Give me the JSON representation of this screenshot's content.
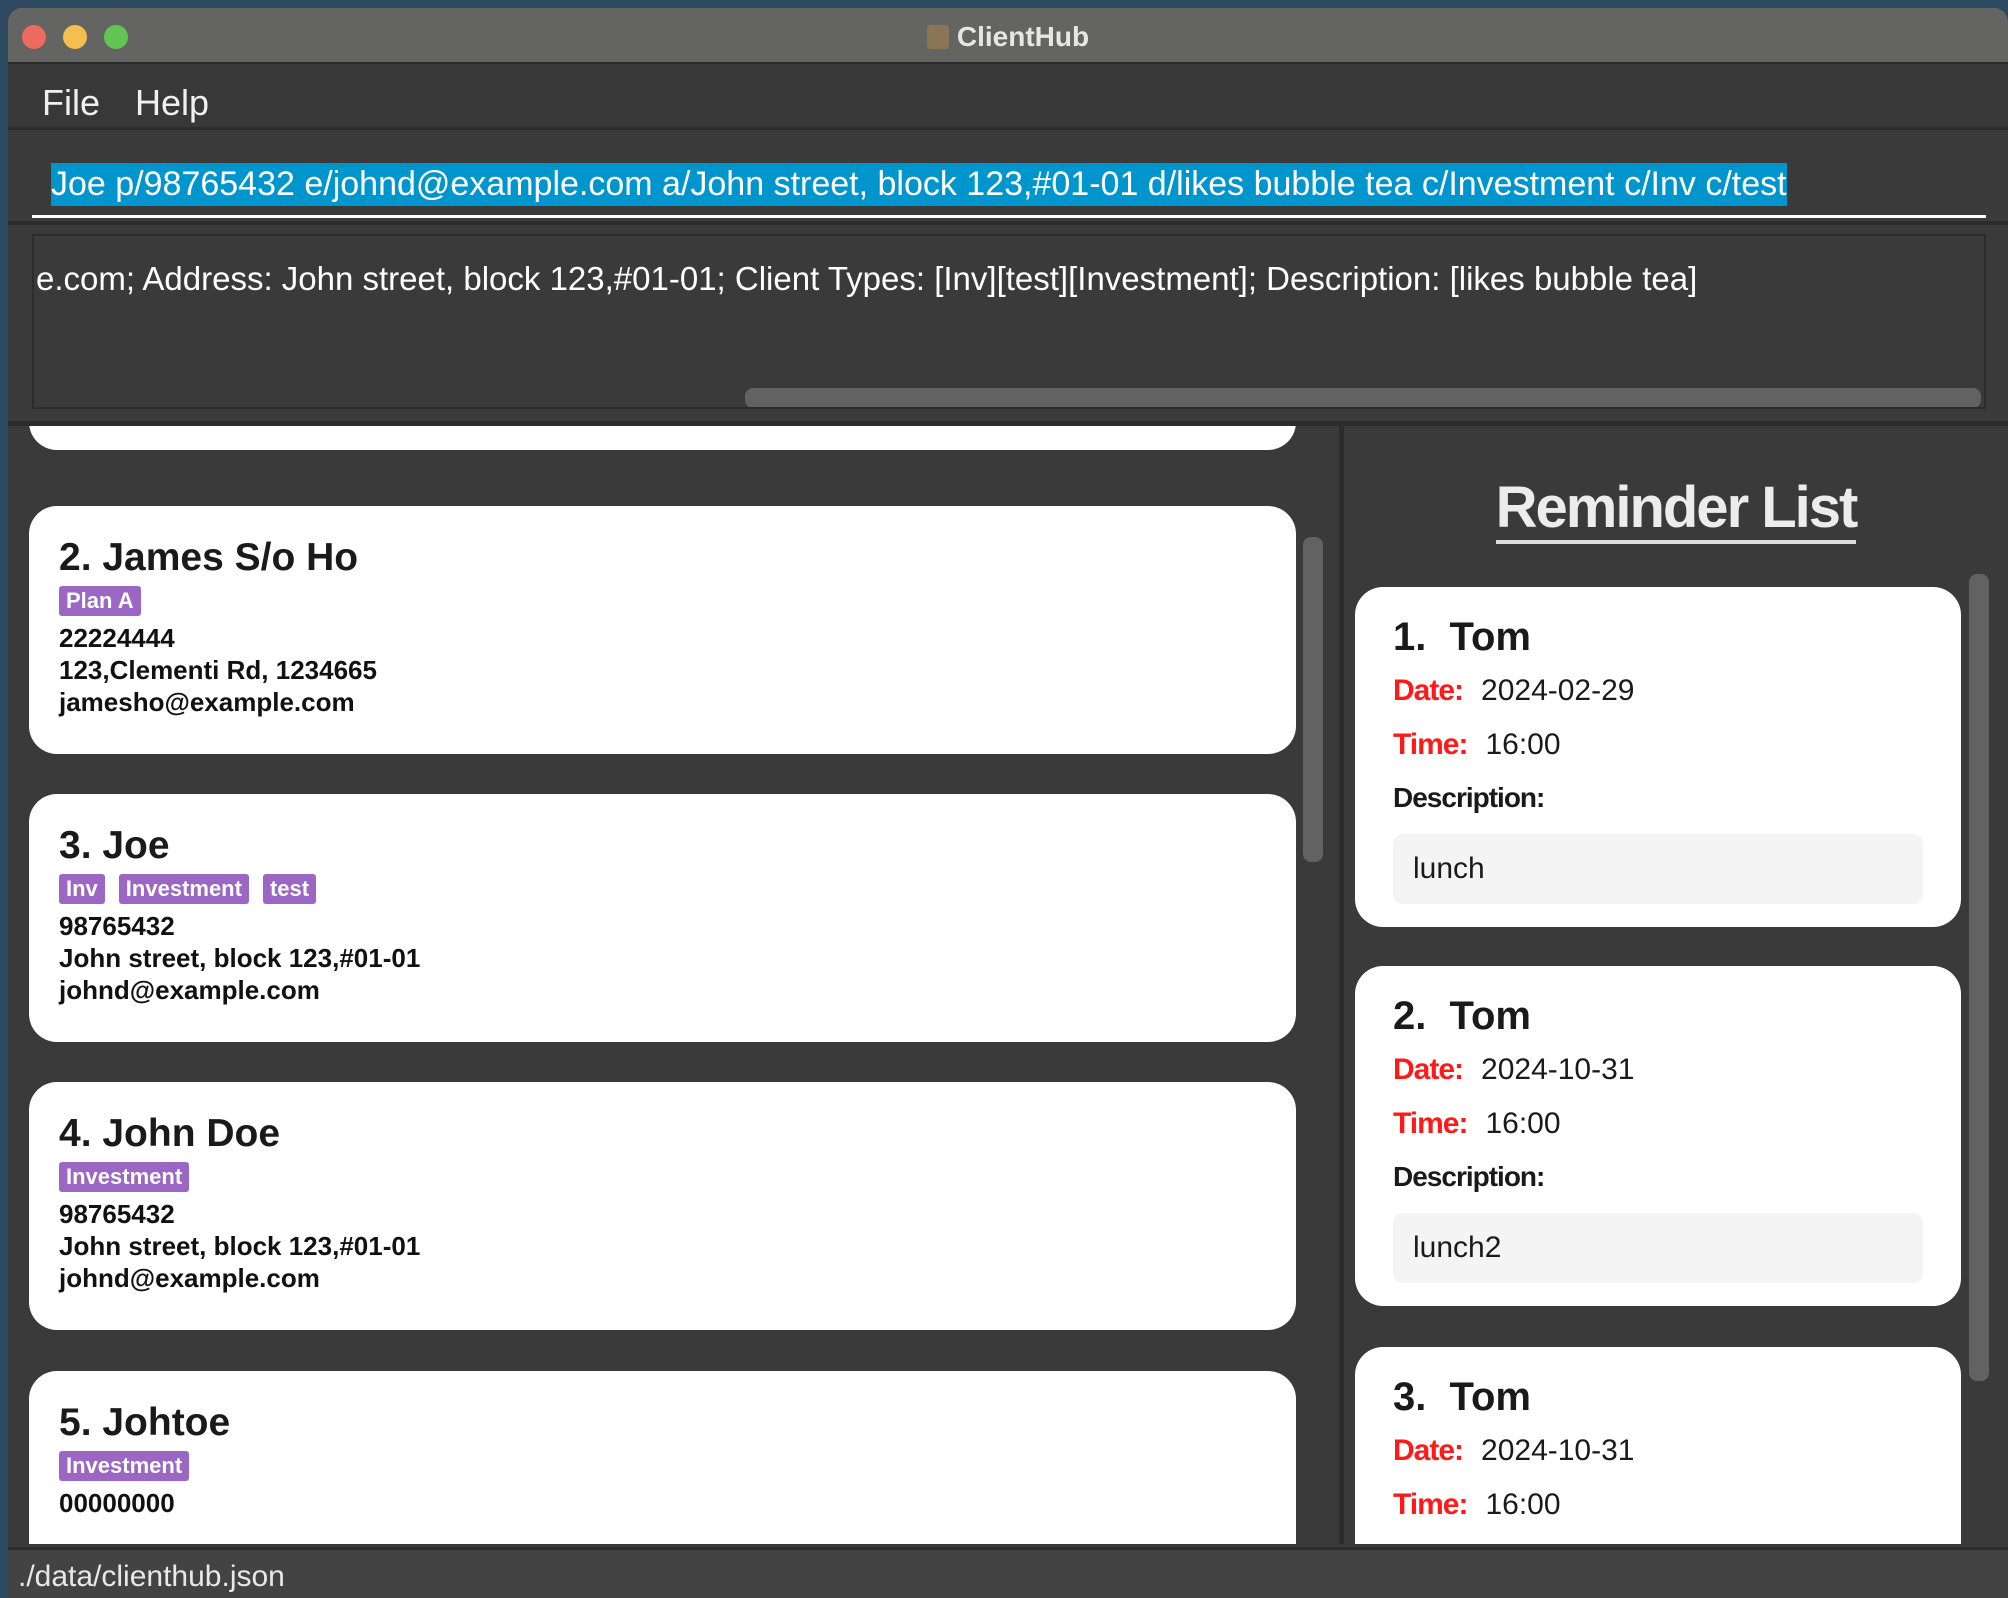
{
  "window": {
    "title": "ClientHub",
    "traffic_lights": [
      "#ec6a5e",
      "#f4bf4f",
      "#61c554"
    ]
  },
  "menu": [
    "File",
    "Help"
  ],
  "command_box": {
    "value": "Joe p/98765432 e/johnd@example.com a/John street, block 123,#01-01 d/likes bubble tea c/Investment c/Inv c/test"
  },
  "result_display": {
    "text": "e.com; Address: John street, block 123,#01-01; Client Types: [Inv][test][Investment]; Description: [likes bubble tea]"
  },
  "clients": [
    {
      "name": "2. James S/o Ho",
      "tags": [
        "Plan A"
      ],
      "lines": [
        "22224444",
        "123,Clementi Rd, 1234665",
        "jamesho@example.com"
      ]
    },
    {
      "name": "3. Joe",
      "tags": [
        "Inv",
        "Investment",
        "test"
      ],
      "lines": [
        "98765432",
        "John street, block 123,#01-01",
        "johnd@example.com"
      ]
    },
    {
      "name": "4. John Doe",
      "tags": [
        "Investment"
      ],
      "lines": [
        "98765432",
        "John street, block 123,#01-01",
        "johnd@example.com"
      ]
    },
    {
      "name": "5. Johtoe",
      "tags": [
        "Investment"
      ],
      "lines": [
        "00000000"
      ]
    }
  ],
  "reminders": {
    "title": "Reminder List",
    "date_label": "Date:",
    "time_label": "Time:",
    "description_label": "Description:",
    "items": [
      {
        "name": "1. Tom",
        "date": "2024-02-29",
        "time": "16:00",
        "description": "lunch"
      },
      {
        "name": "2. Tom",
        "date": "2024-10-31",
        "time": "16:00",
        "description": "lunch2"
      },
      {
        "name": "3. Tom",
        "date": "2024-10-31",
        "time": "16:00"
      }
    ]
  },
  "status_bar": {
    "path": "./data/clienthub.json"
  },
  "colors": {
    "tag": "#9b66c4",
    "selection": "#0095cc",
    "label_red": "#ff1a1a"
  }
}
